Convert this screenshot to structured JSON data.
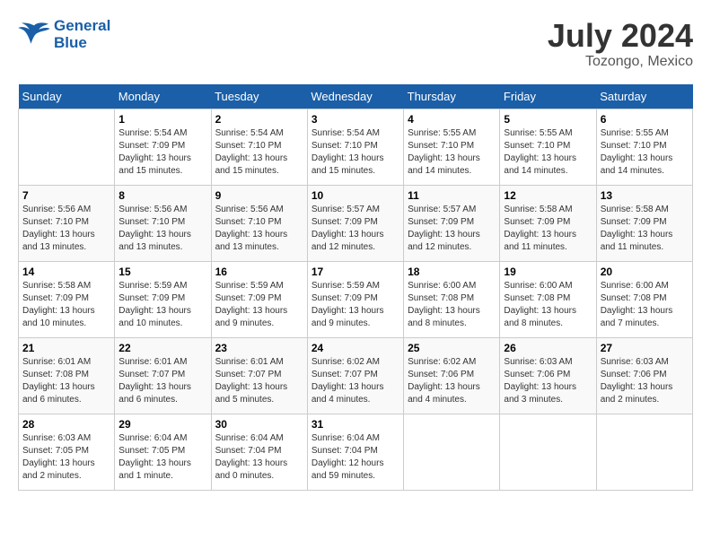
{
  "header": {
    "logo_line1": "General",
    "logo_line2": "Blue",
    "month": "July 2024",
    "location": "Tozongo, Mexico"
  },
  "weekdays": [
    "Sunday",
    "Monday",
    "Tuesday",
    "Wednesday",
    "Thursday",
    "Friday",
    "Saturday"
  ],
  "weeks": [
    [
      {
        "day": "",
        "sunrise": "",
        "sunset": "",
        "daylight": ""
      },
      {
        "day": "1",
        "sunrise": "Sunrise: 5:54 AM",
        "sunset": "Sunset: 7:09 PM",
        "daylight": "Daylight: 13 hours and 15 minutes."
      },
      {
        "day": "2",
        "sunrise": "Sunrise: 5:54 AM",
        "sunset": "Sunset: 7:10 PM",
        "daylight": "Daylight: 13 hours and 15 minutes."
      },
      {
        "day": "3",
        "sunrise": "Sunrise: 5:54 AM",
        "sunset": "Sunset: 7:10 PM",
        "daylight": "Daylight: 13 hours and 15 minutes."
      },
      {
        "day": "4",
        "sunrise": "Sunrise: 5:55 AM",
        "sunset": "Sunset: 7:10 PM",
        "daylight": "Daylight: 13 hours and 14 minutes."
      },
      {
        "day": "5",
        "sunrise": "Sunrise: 5:55 AM",
        "sunset": "Sunset: 7:10 PM",
        "daylight": "Daylight: 13 hours and 14 minutes."
      },
      {
        "day": "6",
        "sunrise": "Sunrise: 5:55 AM",
        "sunset": "Sunset: 7:10 PM",
        "daylight": "Daylight: 13 hours and 14 minutes."
      }
    ],
    [
      {
        "day": "7",
        "sunrise": "Sunrise: 5:56 AM",
        "sunset": "Sunset: 7:10 PM",
        "daylight": "Daylight: 13 hours and 13 minutes."
      },
      {
        "day": "8",
        "sunrise": "Sunrise: 5:56 AM",
        "sunset": "Sunset: 7:10 PM",
        "daylight": "Daylight: 13 hours and 13 minutes."
      },
      {
        "day": "9",
        "sunrise": "Sunrise: 5:56 AM",
        "sunset": "Sunset: 7:10 PM",
        "daylight": "Daylight: 13 hours and 13 minutes."
      },
      {
        "day": "10",
        "sunrise": "Sunrise: 5:57 AM",
        "sunset": "Sunset: 7:09 PM",
        "daylight": "Daylight: 13 hours and 12 minutes."
      },
      {
        "day": "11",
        "sunrise": "Sunrise: 5:57 AM",
        "sunset": "Sunset: 7:09 PM",
        "daylight": "Daylight: 13 hours and 12 minutes."
      },
      {
        "day": "12",
        "sunrise": "Sunrise: 5:58 AM",
        "sunset": "Sunset: 7:09 PM",
        "daylight": "Daylight: 13 hours and 11 minutes."
      },
      {
        "day": "13",
        "sunrise": "Sunrise: 5:58 AM",
        "sunset": "Sunset: 7:09 PM",
        "daylight": "Daylight: 13 hours and 11 minutes."
      }
    ],
    [
      {
        "day": "14",
        "sunrise": "Sunrise: 5:58 AM",
        "sunset": "Sunset: 7:09 PM",
        "daylight": "Daylight: 13 hours and 10 minutes."
      },
      {
        "day": "15",
        "sunrise": "Sunrise: 5:59 AM",
        "sunset": "Sunset: 7:09 PM",
        "daylight": "Daylight: 13 hours and 10 minutes."
      },
      {
        "day": "16",
        "sunrise": "Sunrise: 5:59 AM",
        "sunset": "Sunset: 7:09 PM",
        "daylight": "Daylight: 13 hours and 9 minutes."
      },
      {
        "day": "17",
        "sunrise": "Sunrise: 5:59 AM",
        "sunset": "Sunset: 7:09 PM",
        "daylight": "Daylight: 13 hours and 9 minutes."
      },
      {
        "day": "18",
        "sunrise": "Sunrise: 6:00 AM",
        "sunset": "Sunset: 7:08 PM",
        "daylight": "Daylight: 13 hours and 8 minutes."
      },
      {
        "day": "19",
        "sunrise": "Sunrise: 6:00 AM",
        "sunset": "Sunset: 7:08 PM",
        "daylight": "Daylight: 13 hours and 8 minutes."
      },
      {
        "day": "20",
        "sunrise": "Sunrise: 6:00 AM",
        "sunset": "Sunset: 7:08 PM",
        "daylight": "Daylight: 13 hours and 7 minutes."
      }
    ],
    [
      {
        "day": "21",
        "sunrise": "Sunrise: 6:01 AM",
        "sunset": "Sunset: 7:08 PM",
        "daylight": "Daylight: 13 hours and 6 minutes."
      },
      {
        "day": "22",
        "sunrise": "Sunrise: 6:01 AM",
        "sunset": "Sunset: 7:07 PM",
        "daylight": "Daylight: 13 hours and 6 minutes."
      },
      {
        "day": "23",
        "sunrise": "Sunrise: 6:01 AM",
        "sunset": "Sunset: 7:07 PM",
        "daylight": "Daylight: 13 hours and 5 minutes."
      },
      {
        "day": "24",
        "sunrise": "Sunrise: 6:02 AM",
        "sunset": "Sunset: 7:07 PM",
        "daylight": "Daylight: 13 hours and 4 minutes."
      },
      {
        "day": "25",
        "sunrise": "Sunrise: 6:02 AM",
        "sunset": "Sunset: 7:06 PM",
        "daylight": "Daylight: 13 hours and 4 minutes."
      },
      {
        "day": "26",
        "sunrise": "Sunrise: 6:03 AM",
        "sunset": "Sunset: 7:06 PM",
        "daylight": "Daylight: 13 hours and 3 minutes."
      },
      {
        "day": "27",
        "sunrise": "Sunrise: 6:03 AM",
        "sunset": "Sunset: 7:06 PM",
        "daylight": "Daylight: 13 hours and 2 minutes."
      }
    ],
    [
      {
        "day": "28",
        "sunrise": "Sunrise: 6:03 AM",
        "sunset": "Sunset: 7:05 PM",
        "daylight": "Daylight: 13 hours and 2 minutes."
      },
      {
        "day": "29",
        "sunrise": "Sunrise: 6:04 AM",
        "sunset": "Sunset: 7:05 PM",
        "daylight": "Daylight: 13 hours and 1 minute."
      },
      {
        "day": "30",
        "sunrise": "Sunrise: 6:04 AM",
        "sunset": "Sunset: 7:04 PM",
        "daylight": "Daylight: 13 hours and 0 minutes."
      },
      {
        "day": "31",
        "sunrise": "Sunrise: 6:04 AM",
        "sunset": "Sunset: 7:04 PM",
        "daylight": "Daylight: 12 hours and 59 minutes."
      },
      {
        "day": "",
        "sunrise": "",
        "sunset": "",
        "daylight": ""
      },
      {
        "day": "",
        "sunrise": "",
        "sunset": "",
        "daylight": ""
      },
      {
        "day": "",
        "sunrise": "",
        "sunset": "",
        "daylight": ""
      }
    ]
  ]
}
